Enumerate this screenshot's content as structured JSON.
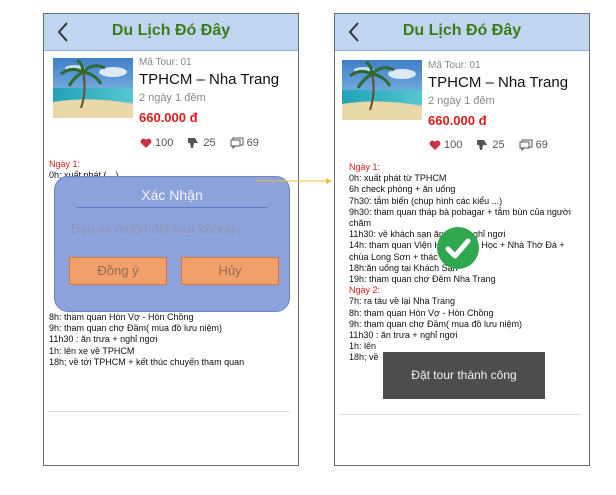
{
  "app_title": "Du Lịch Đó Đây",
  "tour": {
    "code": "Mã Tour: 01",
    "route": "TPHCM – Nha Trang",
    "duration": "2 ngày 1 đêm",
    "price": "660.000 đ",
    "likes": "100",
    "dislikes": "25",
    "comments": "69"
  },
  "left_itinerary_top": [
    {
      "text": "Ngày 1:",
      "day": true
    },
    {
      "text": "0h: xuất phát (…)"
    }
  ],
  "left_itinerary_bottom": [
    {
      "text": "8h: tham quan Hòn Vợ - Hòn Chồng"
    },
    {
      "text": "9h: tham quan chợ Đầm( mua đồ lưu niệm)"
    },
    {
      "text": "11h30 : ăn trưa + nghỉ ngơi"
    },
    {
      "text": "1h: lên xe về TPHCM"
    },
    {
      "text": "18h; về tới TPHCM + kết thúc chuyến tham quan"
    }
  ],
  "right_itinerary": [
    {
      "text": "Ngày 1:",
      "day": true
    },
    {
      "text": "0h: xuất phát từ TPHCM"
    },
    {
      "text": "6h check phòng + ăn uống"
    },
    {
      "text": "7h30: tắm biển (chụp hình các kiểu ...)"
    },
    {
      "text": "9h30: tham quan tháp bà pobagar + tắm bùn của người"
    },
    {
      "text": "chăm"
    },
    {
      "text": "11h30: về khách sạn ăn trưa, nghỉ ngơi"
    },
    {
      "text": "14h: tham quan Viện Hải Dương Học + Nhà Thờ Đá +"
    },
    {
      "text": "chùa Long Sơn + thác"
    },
    {
      "text": "18h:ăn uống tại Khách Sạn"
    },
    {
      "text": "19h: tham quan chợ Đêm Nha Trang"
    },
    {
      "text": "Ngày 2:",
      "day": true
    },
    {
      "text": "7h: ra tàu về lại Nha Trang"
    },
    {
      "text": "8h: tham quan Hòn Vợ - Hòn Chồng"
    },
    {
      "text": "9h: tham quan chợ Đầm( mua đồ lưu niệm)"
    },
    {
      "text": "11h30 : ăn trưa + nghỉ ngơi"
    },
    {
      "text": "1h: lên"
    },
    {
      "text": "18h; về"
    }
  ],
  "dialog": {
    "title": "Xác Nhận",
    "message": "Bạn có muốn đặt tour không.",
    "ok": "Đồng ý",
    "cancel": "Hủy"
  },
  "toast": "Đặt tour thành công",
  "icons": [
    "back-icon",
    "heart-icon",
    "thumbs-down-icon",
    "comment-icon",
    "check-icon"
  ],
  "colors": {
    "header_bg": "#c0d6f0",
    "title": "#3c7b19",
    "price": "#e01b1b",
    "dialog_bg": "#839bd8",
    "button_bg": "#f2a06b",
    "toast_bg": "#4d4d4d",
    "check": "#2fa84f"
  }
}
